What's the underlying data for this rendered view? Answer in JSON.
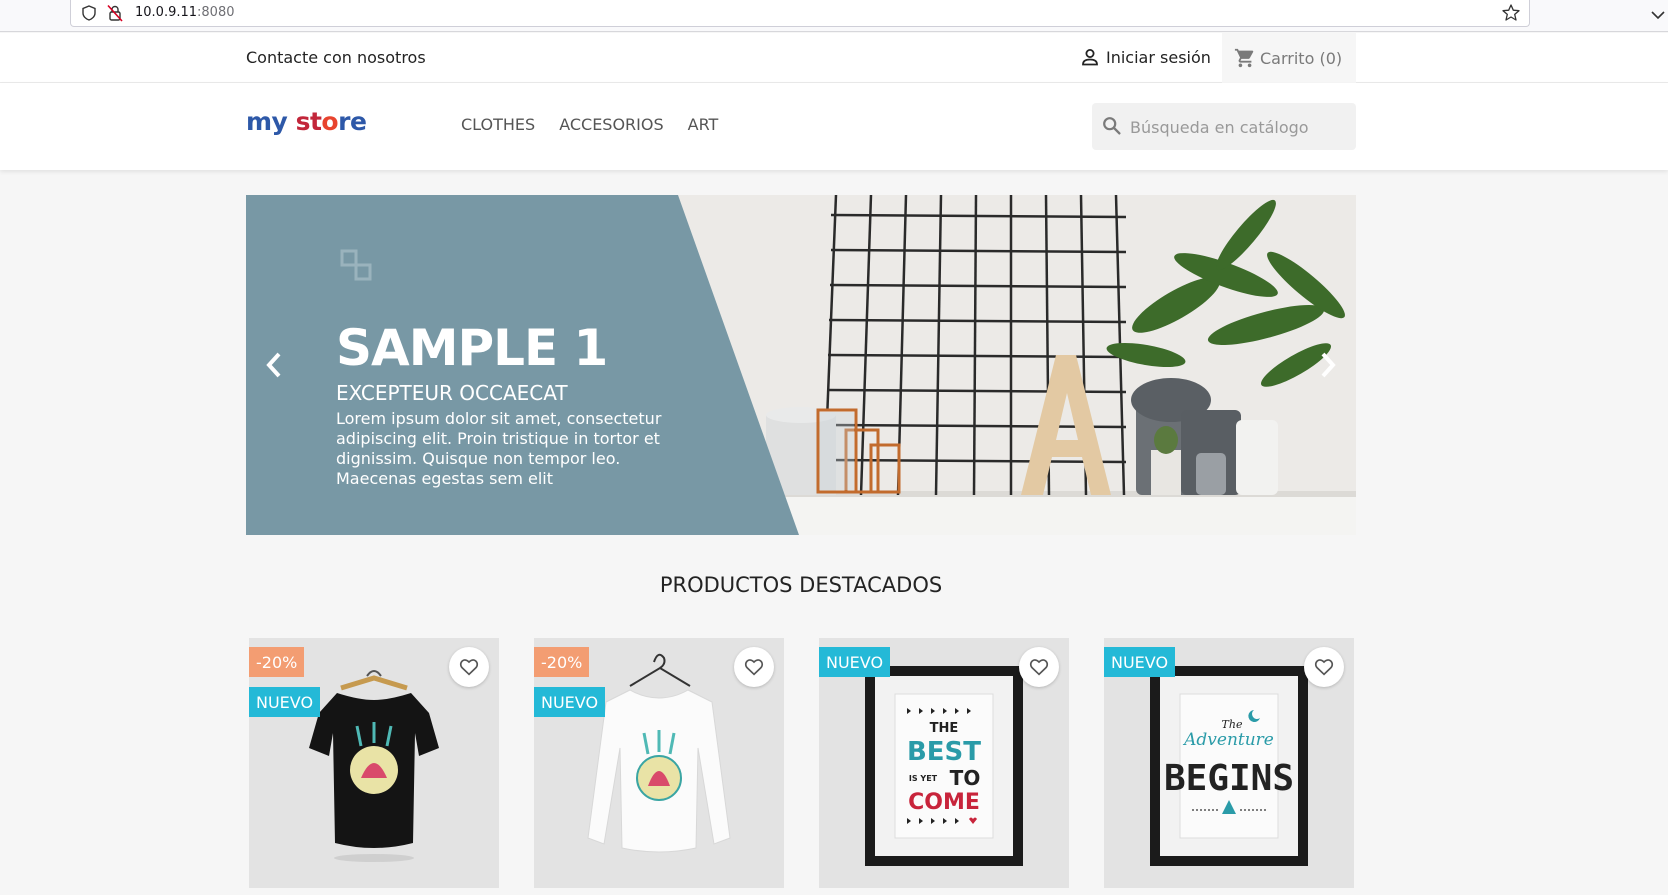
{
  "browser": {
    "url_host": "10.0.9.11",
    "url_port": ":8080"
  },
  "top_nav": {
    "contact": "Contacte con nosotros",
    "signin": "Iniciar sesión",
    "cart": "Carrito (0)"
  },
  "header": {
    "logo_parts": [
      "my",
      " ",
      "st",
      "o",
      "re"
    ],
    "menu": [
      "CLOTHES",
      "ACCESORIOS",
      "ART"
    ],
    "search_placeholder": "Búsqueda en catálogo"
  },
  "slider": {
    "title": "SAMPLE 1",
    "subtitle": "EXCEPTEUR OCCAECAT",
    "text": "Lorem ipsum dolor sit amet, consectetur adipiscing elit. Proin tristique in tortor et dignissim. Quisque non tempor leo. Maecenas egestas sem elit"
  },
  "section": {
    "title": "PRODUCTOS DESTACADOS"
  },
  "products": [
    {
      "discount": "-20%",
      "new": "NUEVO"
    },
    {
      "discount": "-20%",
      "new": "NUEVO"
    },
    {
      "discount": "",
      "new": "NUEVO"
    },
    {
      "discount": "",
      "new": "NUEVO"
    }
  ],
  "colors": {
    "slide_panel": "#7898a5",
    "badge_new": "#24b9d7",
    "badge_discount": "#f39d72"
  },
  "icons": {
    "shield": "shield-icon",
    "lock": "insecure-lock-icon",
    "star": "bookmark-star-icon",
    "user": "user-icon",
    "cart": "cart-icon",
    "search": "search-icon",
    "heart": "heart-icon",
    "prev": "chevron-left-icon",
    "next": "chevron-right-icon"
  }
}
